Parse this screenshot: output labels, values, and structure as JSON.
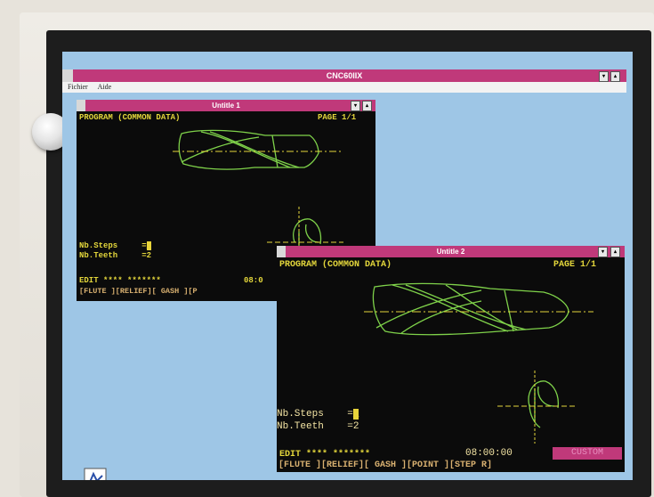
{
  "app": {
    "title": "CNC60IIX",
    "menu": [
      "Fichier",
      "Aide"
    ]
  },
  "windows": [
    {
      "title": "Untitle 1",
      "header": "PROGRAM (COMMON DATA)",
      "page": "PAGE 1/1",
      "fields": [
        {
          "label": "Nb.Steps",
          "value": "="
        },
        {
          "label": "Nb.Teeth",
          "value": "=2"
        }
      ],
      "status": "EDIT **** *******",
      "time": "08:0",
      "softkeys": "[FLUTE ][RELIEF][ GASH ][P"
    },
    {
      "title": "Untitle 2",
      "header": "PROGRAM (COMMON DATA)",
      "page": "PAGE 1/1",
      "fields": [
        {
          "label": "Nb.Steps",
          "value": "="
        },
        {
          "label": "Nb.Teeth",
          "value": "=2"
        }
      ],
      "status": "EDIT **** *******",
      "time": "08:00:00",
      "custom_label": "CUSTOM",
      "softkeys": "[FLUTE ][RELIEF][ GASH ][POINT ][STEP R]"
    }
  ],
  "colors": {
    "title_bar": "#c0397a",
    "desktop": "#9ec6e6",
    "cnc_text": "#e3d63b",
    "drawing": "#7fd24a"
  },
  "icons": [
    "desktop-program-icon"
  ]
}
